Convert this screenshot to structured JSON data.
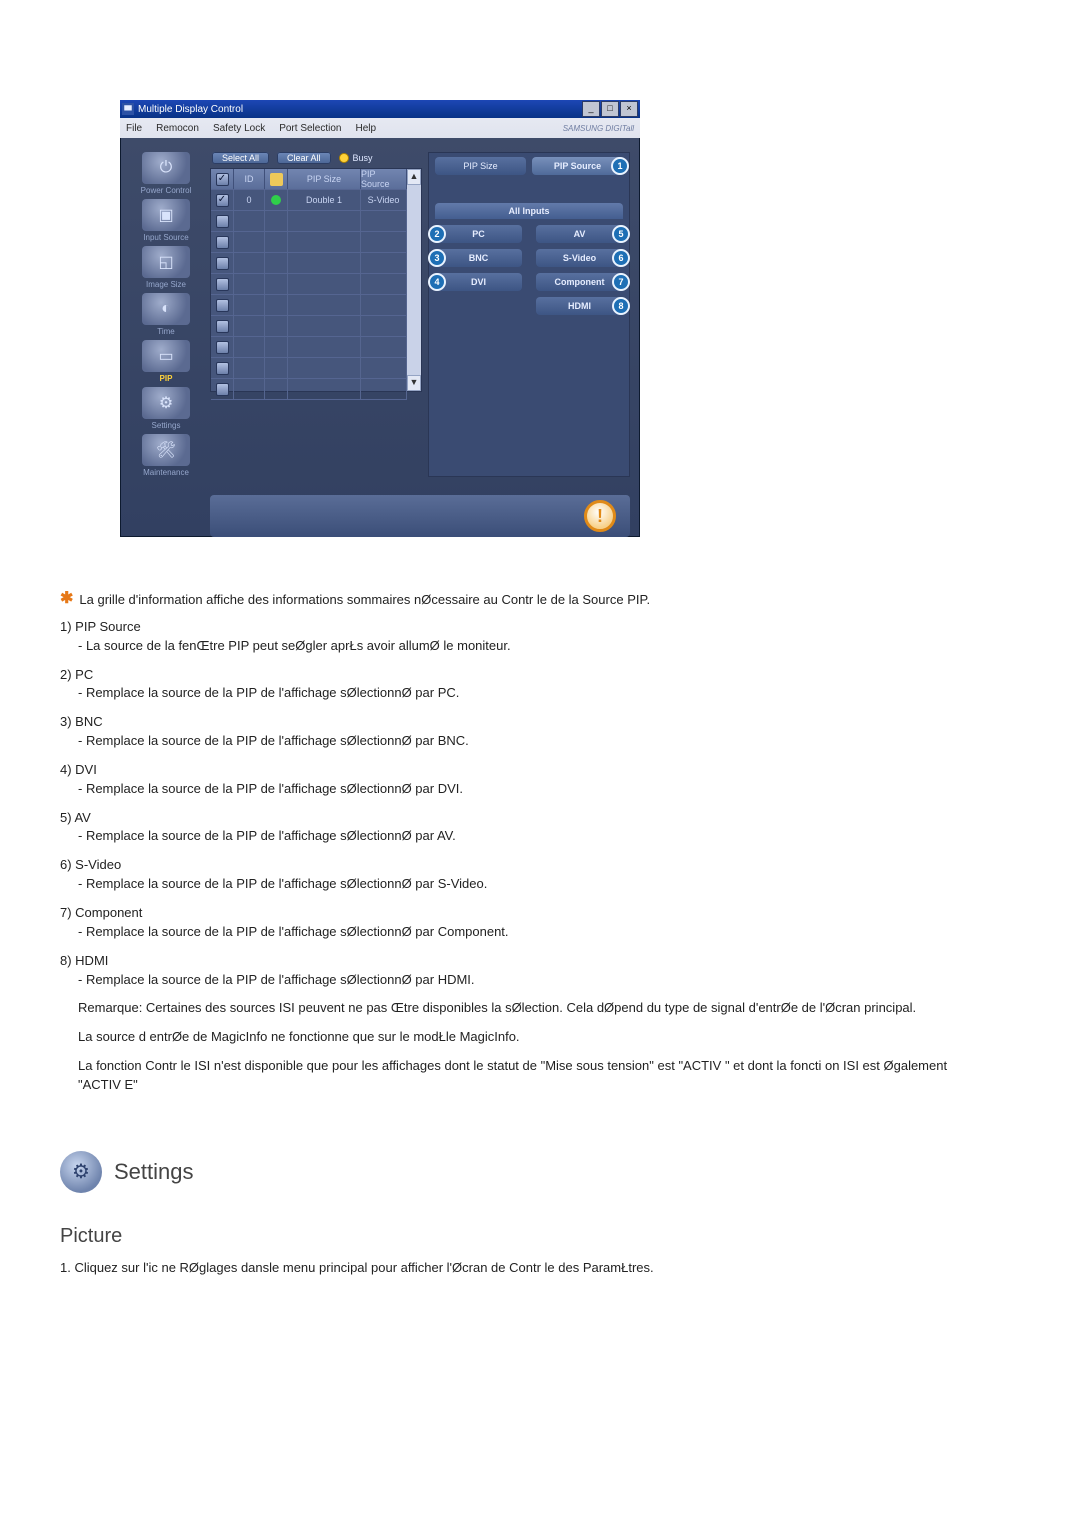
{
  "window": {
    "title": "Multiple Display Control",
    "menubar": [
      "File",
      "Remocon",
      "Safety Lock",
      "Port Selection",
      "Help"
    ],
    "brand": "SAMSUNG DIGITall"
  },
  "sidebar": [
    {
      "label": "Power Control"
    },
    {
      "label": "Input Source"
    },
    {
      "label": "Image Size"
    },
    {
      "label": "Time"
    },
    {
      "label": "PIP"
    },
    {
      "label": "Settings"
    },
    {
      "label": "Maintenance"
    }
  ],
  "list_toolbar": {
    "select_all": "Select All",
    "clear_all": "Clear All",
    "busy": "Busy"
  },
  "grid": {
    "headers": {
      "id": "ID",
      "pip_size": "PIP Size",
      "pip_source": "PIP Source"
    },
    "rows": [
      {
        "checked": true,
        "id": "0",
        "status": "on",
        "pip_size": "Double 1",
        "pip_source": "S-Video"
      },
      {
        "checked": false,
        "id": "",
        "status": "",
        "pip_size": "",
        "pip_source": ""
      },
      {
        "checked": false,
        "id": "",
        "status": "",
        "pip_size": "",
        "pip_source": ""
      },
      {
        "checked": false,
        "id": "",
        "status": "",
        "pip_size": "",
        "pip_source": ""
      },
      {
        "checked": false,
        "id": "",
        "status": "",
        "pip_size": "",
        "pip_source": ""
      },
      {
        "checked": false,
        "id": "",
        "status": "",
        "pip_size": "",
        "pip_source": ""
      },
      {
        "checked": false,
        "id": "",
        "status": "",
        "pip_size": "",
        "pip_source": ""
      },
      {
        "checked": false,
        "id": "",
        "status": "",
        "pip_size": "",
        "pip_source": ""
      },
      {
        "checked": false,
        "id": "",
        "status": "",
        "pip_size": "",
        "pip_source": ""
      },
      {
        "checked": false,
        "id": "",
        "status": "",
        "pip_size": "",
        "pip_source": ""
      }
    ]
  },
  "rpanel": {
    "tabs": {
      "pip_size": "PIP Size",
      "pip_source": "PIP Source"
    },
    "tab_badge": "1",
    "all_inputs": "All Inputs",
    "sources_left": [
      {
        "label": "PC",
        "badge": "2"
      },
      {
        "label": "BNC",
        "badge": "3"
      },
      {
        "label": "DVI",
        "badge": "4"
      }
    ],
    "sources_right": [
      {
        "label": "AV",
        "badge": "5"
      },
      {
        "label": "S-Video",
        "badge": "6"
      },
      {
        "label": "Component",
        "badge": "7"
      },
      {
        "label": "HDMI",
        "badge": "8"
      }
    ]
  },
  "doc": {
    "intro": "La grille d'information affiche des informations sommaires nØcessaire au Contr le de la Source PIP.",
    "items": [
      {
        "n": "1)",
        "title": "PIP Source",
        "desc": "- La source de la fenŒtre PIP peut seØgler aprŁs avoir allumØ le moniteur."
      },
      {
        "n": "2)",
        "title": "PC",
        "desc": "- Remplace la source de la PIP de l'affichage sØlectionnØ par PC."
      },
      {
        "n": "3)",
        "title": "BNC",
        "desc": "- Remplace la source de la PIP de l'affichage sØlectionnØ par BNC."
      },
      {
        "n": "4)",
        "title": "DVI",
        "desc": "- Remplace la source de la PIP de l'affichage sØlectionnØ par DVI."
      },
      {
        "n": "5)",
        "title": "AV",
        "desc": "- Remplace la source de la PIP de l'affichage sØlectionnØ par AV."
      },
      {
        "n": "6)",
        "title": "S-Video",
        "desc": "- Remplace la source de la PIP de l'affichage sØlectionnØ par S-Video."
      },
      {
        "n": "7)",
        "title": "Component",
        "desc": "- Remplace la source de la PIP de l'affichage sØlectionnØ par Component."
      },
      {
        "n": "8)",
        "title": "HDMI",
        "desc": "- Remplace la source de la PIP de l'affichage sØlectionnØ par HDMI."
      }
    ],
    "notes": [
      "Remarque: Certaines des sources ISI peuvent ne pas Œtre disponibles   la sØlection. Cela dØpend du type de signal d'entrØe     de l'Øcran principal.",
      "La source d entrØe de MagicInfo ne fonctionne que sur le modŁle MagicInfo.",
      "La fonction Contr le ISI n'est disponible que pour les affichages dont le statut de \"Mise sous tension\" est \"ACTIV \" et dont la foncti       on ISI est Øgalement \"ACTIV E\""
    ]
  },
  "settings_section": {
    "title": "Settings",
    "subhead": "Picture",
    "step1": "1.  Cliquez sur l'ic ne RØglages dansle menu principal pour afficher l'Øcran de Contr le des ParamŁtres."
  }
}
